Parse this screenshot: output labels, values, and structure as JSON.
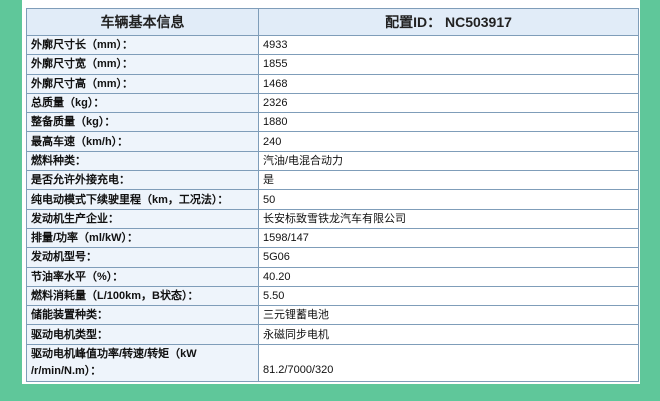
{
  "header": {
    "left_title": "车辆基本信息",
    "config_label": "配置ID：",
    "config_id": "NC503917"
  },
  "rows": [
    {
      "label": "外廓尺寸长（mm）：",
      "value": "4933"
    },
    {
      "label": "外廓尺寸宽（mm）：",
      "value": "1855"
    },
    {
      "label": "外廓尺寸高（mm）：",
      "value": "1468"
    },
    {
      "label": "总质量（kg）：",
      "value": "2326"
    },
    {
      "label": "整备质量（kg）：",
      "value": "1880"
    },
    {
      "label": "最高车速（km/h）：",
      "value": "240"
    },
    {
      "label": "燃料种类：",
      "value": "汽油/电混合动力"
    },
    {
      "label": "是否允许外接充电：",
      "value": "是"
    },
    {
      "label": "纯电动模式下续驶里程（km，工况法）：",
      "value": "50"
    },
    {
      "label": "发动机生产企业：",
      "value": "长安标致雪铁龙汽车有限公司"
    },
    {
      "label": "排量/功率（ml/kW）：",
      "value": "1598/147"
    },
    {
      "label": "发动机型号：",
      "value": "5G06"
    },
    {
      "label": "节油率水平（%）：",
      "value": "40.20"
    },
    {
      "label": "燃料消耗量（L/100km，B状态）：",
      "value": "5.50"
    },
    {
      "label": "储能装置种类：",
      "value": "三元锂蓄电池"
    },
    {
      "label": "驱动电机类型：",
      "value": "永磁同步电机"
    },
    {
      "label": "驱动电机峰值功率/转速/转矩（kW /r/min/N.m）：",
      "value": "81.2/7000/320"
    }
  ]
}
